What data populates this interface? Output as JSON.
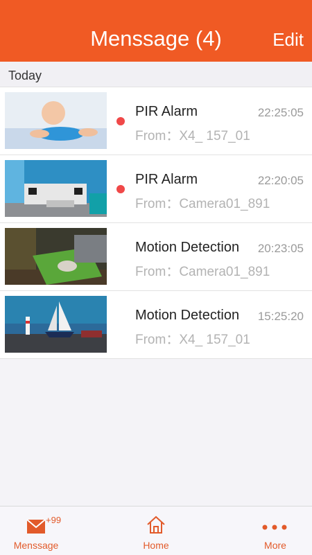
{
  "header": {
    "title": "Menssage (4)",
    "edit_label": "Edit"
  },
  "section": {
    "label": "Today"
  },
  "messages": [
    {
      "title": "PIR Alarm",
      "time": "22:25:05",
      "from": "From：X4_ 157_01",
      "unread": true,
      "thumb": "baby-photo"
    },
    {
      "title": "PIR Alarm",
      "time": "22:20:05",
      "from": "From：Camera01_891",
      "unread": true,
      "thumb": "living-room-photo"
    },
    {
      "title": "Motion Detection",
      "time": "20:23:05",
      "from": "From：Camera01_891",
      "unread": false,
      "thumb": "lounge-photo"
    },
    {
      "title": "Motion Detection",
      "time": "15:25:20",
      "from": "From：X4_ 157_01",
      "unread": false,
      "thumb": "sailboat-photo"
    }
  ],
  "tabbar": {
    "message_label": "Menssage",
    "message_badge": "+99",
    "home_label": "Home",
    "more_label": "More"
  },
  "colors": {
    "accent": "#f05a24",
    "unread_dot": "#f04848",
    "tab_icon": "#e25a2a"
  }
}
